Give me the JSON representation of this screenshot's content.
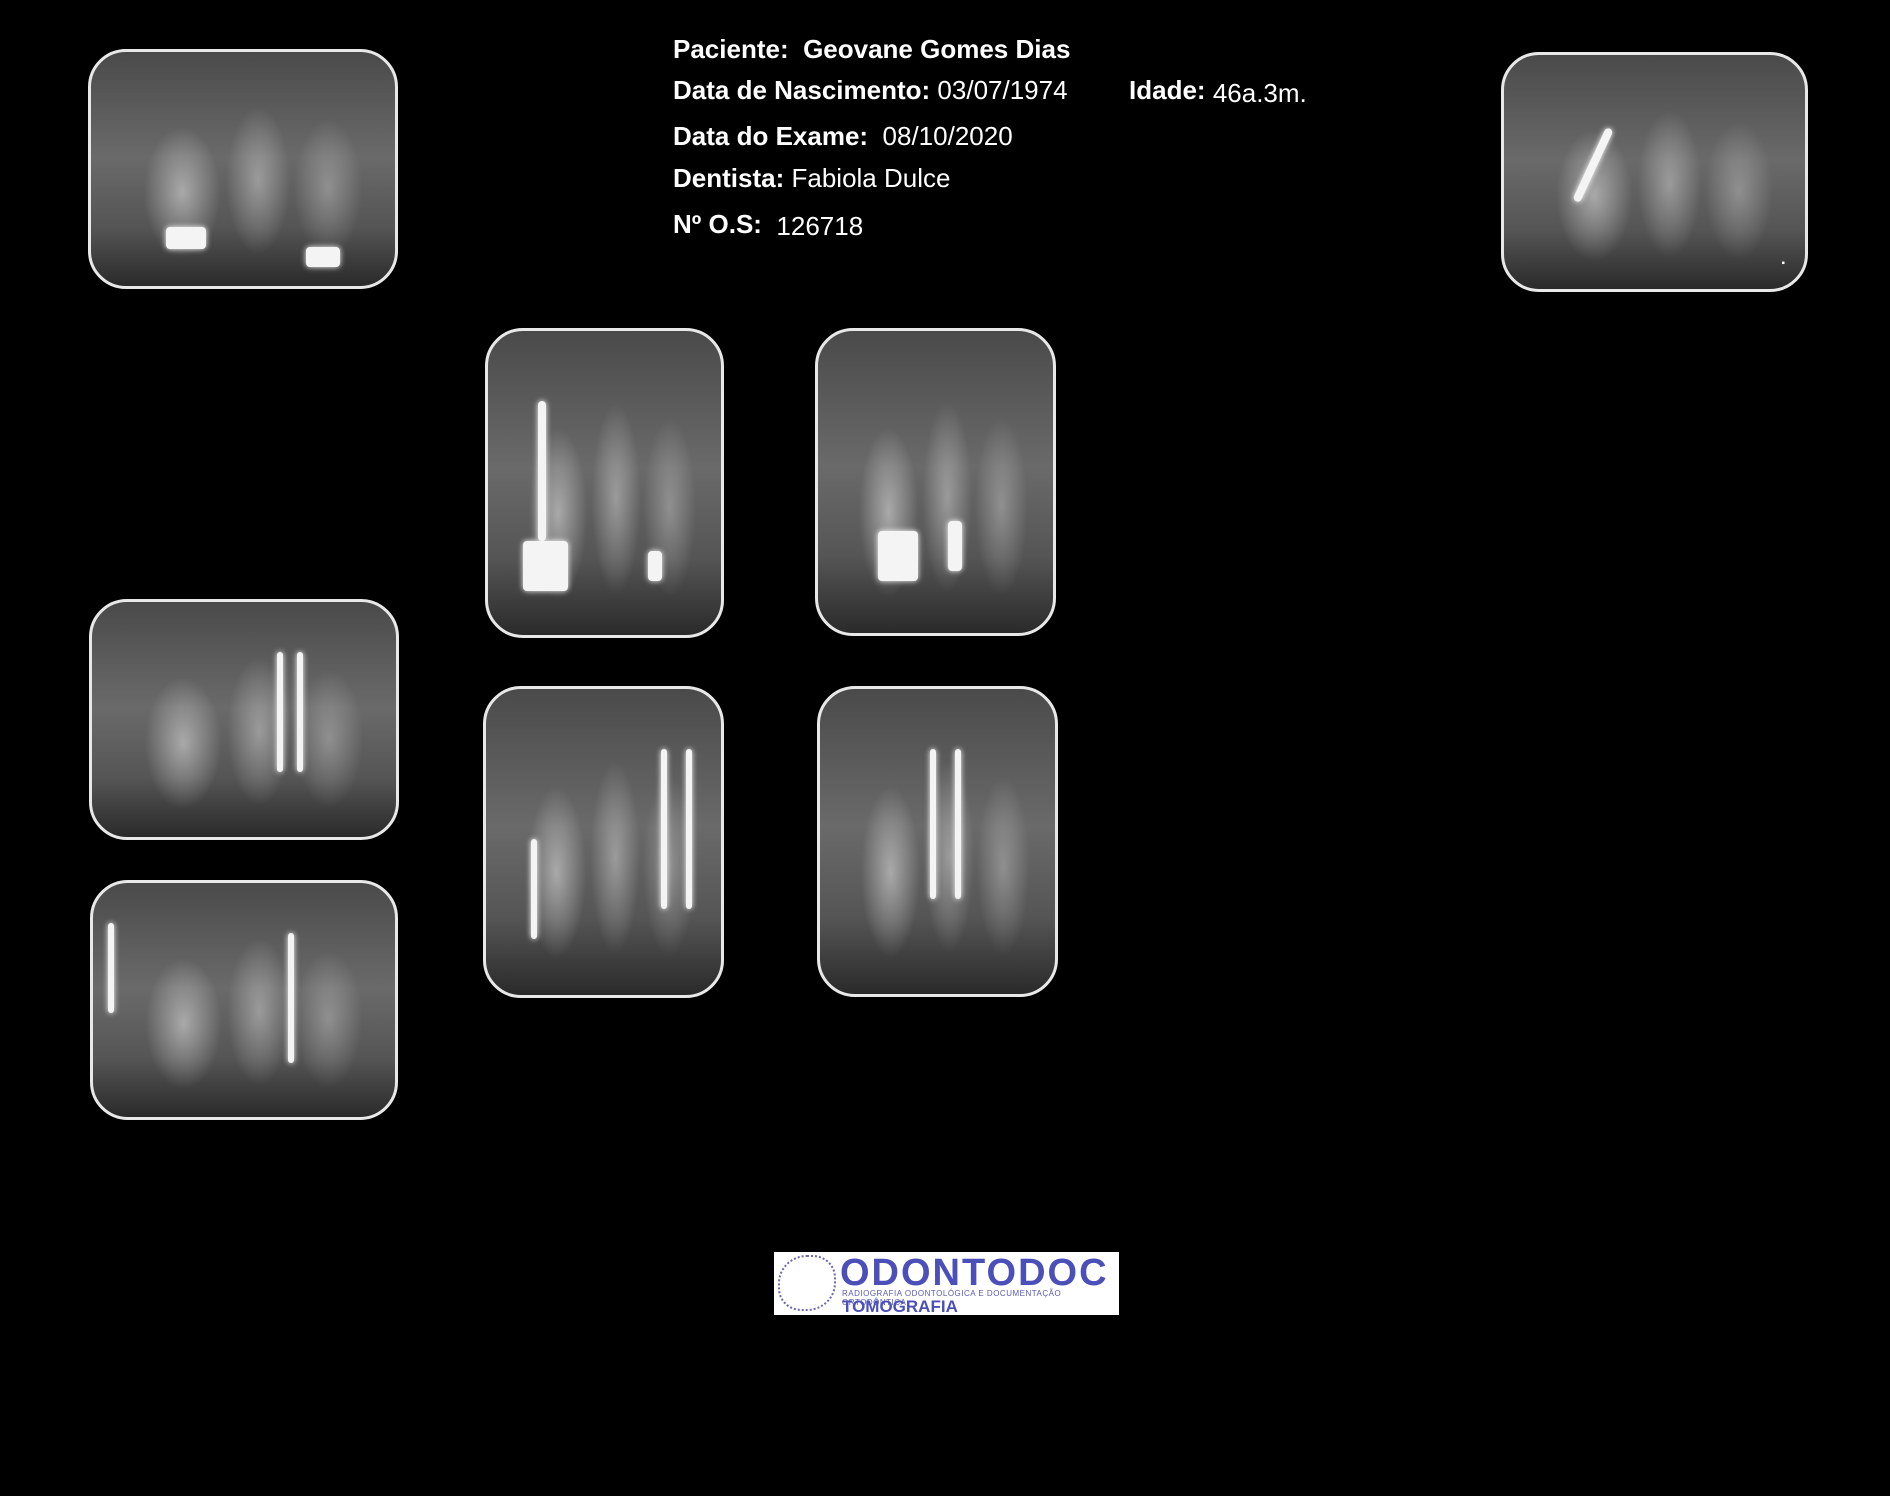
{
  "patient": {
    "name_label": "Paciente:",
    "name": "Geovane Gomes Dias",
    "birth_label": "Data de Nascimento:",
    "birth_date": "03/07/1974",
    "age_label": "Idade:",
    "age": "46a.3m.",
    "exam_label": "Data do Exame:",
    "exam_date": "08/10/2020",
    "dentist_label": "Dentista:",
    "dentist": "Fabiola Dulce",
    "os_label": "Nº O.S:",
    "os_number": "126718"
  },
  "radiographs": [
    {
      "id": "upper-right-posterior"
    },
    {
      "id": "upper-left-posterior"
    },
    {
      "id": "upper-anterior-right"
    },
    {
      "id": "upper-anterior-left"
    },
    {
      "id": "lower-right-molar"
    },
    {
      "id": "lower-right-premolar"
    },
    {
      "id": "lower-anterior-right"
    },
    {
      "id": "lower-anterior-left"
    }
  ],
  "logo": {
    "name": "ODONTODOC",
    "tagline": "RADIOGRAFIA ODONTOLÓGICA E DOCUMENTAÇÃO ORTODÔNTICA",
    "subtitle": "TOMOGRAFIA COMPUTADORIZADA"
  }
}
